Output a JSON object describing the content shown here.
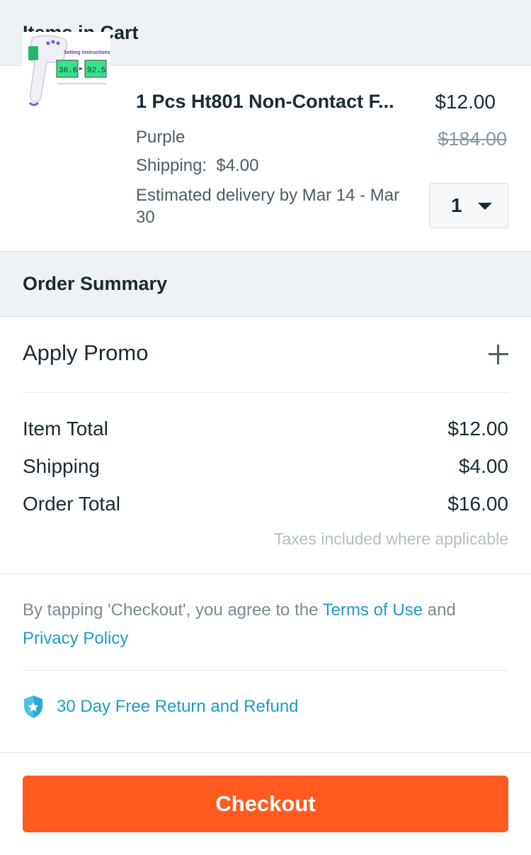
{
  "cart": {
    "header": "Items in Cart",
    "item": {
      "title": "1 Pcs Ht801 Non-Contact F...",
      "variant": "Purple",
      "shipping_label": "Shipping:",
      "shipping_value": "$4.00",
      "delivery": "Estimated delivery by Mar 14 - Mar 30",
      "price": "$12.00",
      "original_price": "$184.00",
      "quantity": "1",
      "thumbnail_caption": "Setting instructions",
      "thumbnail_readings": [
        "36.6",
        "92.5"
      ]
    }
  },
  "summary": {
    "header": "Order Summary",
    "promo_label": "Apply Promo",
    "rows": [
      {
        "label": "Item Total",
        "value": "$12.00"
      },
      {
        "label": "Shipping",
        "value": "$4.00"
      },
      {
        "label": "Order Total",
        "value": "$16.00"
      }
    ],
    "taxes_note": "Taxes included where applicable"
  },
  "legal": {
    "prefix": "By tapping 'Checkout', you agree to the",
    "terms_link": "Terms of Use",
    "conjunction": "and",
    "privacy_link": "Privacy Policy"
  },
  "refund": {
    "text": "30 Day Free Return and Refund"
  },
  "checkout": {
    "label": "Checkout"
  },
  "colors": {
    "accent": "#ff5a1f",
    "link": "#1e9bc7",
    "header_bg": "#eef2f5"
  }
}
